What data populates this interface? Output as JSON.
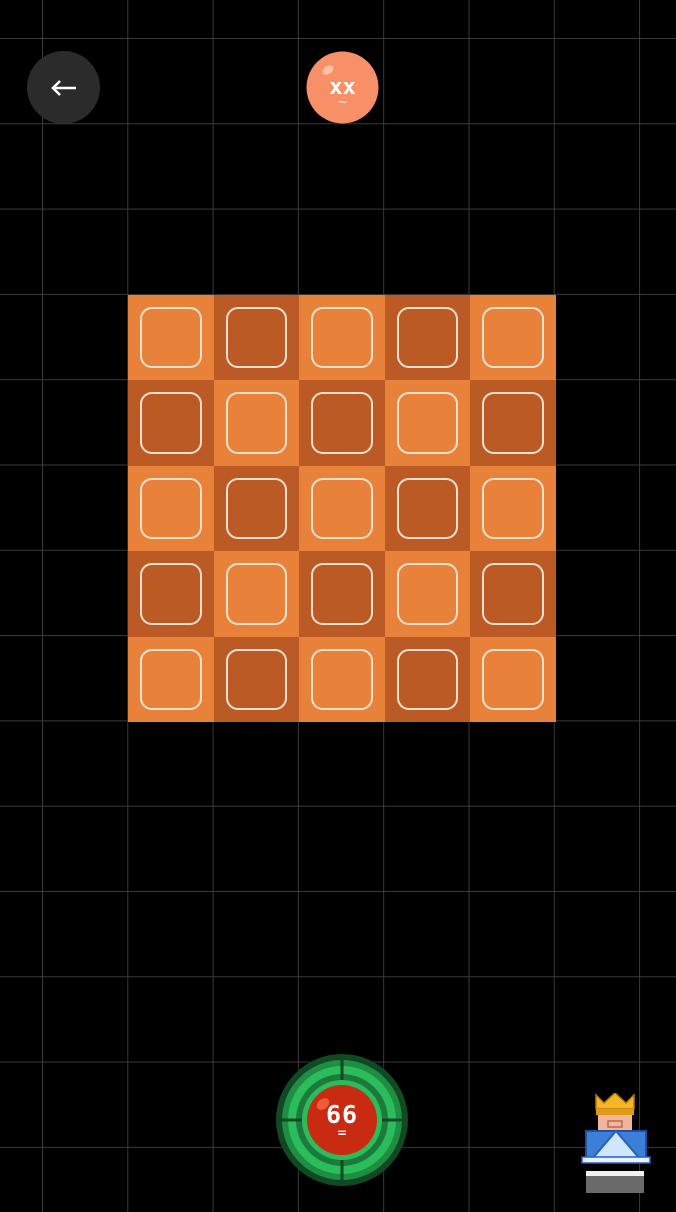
{
  "header": {
    "back_icon": "left-arrow-icon",
    "face_icon": "dizzy-face-icon",
    "face_text": "xx",
    "face_mouth": "~"
  },
  "board": {
    "rows": 5,
    "cols": 5,
    "pattern": [
      [
        "light",
        "dark",
        "light",
        "dark",
        "light"
      ],
      [
        "dark",
        "light",
        "dark",
        "light",
        "dark"
      ],
      [
        "light",
        "dark",
        "light",
        "dark",
        "light"
      ],
      [
        "dark",
        "light",
        "dark",
        "light",
        "dark"
      ],
      [
        "light",
        "dark",
        "light",
        "dark",
        "light"
      ]
    ]
  },
  "counter": {
    "value": "66",
    "symbol": "="
  },
  "king_icon": "king-crown-icon",
  "colors": {
    "background": "#000000",
    "grid_line": "#3a3a3a",
    "tile_light": "#e8823a",
    "tile_dark": "#bc5a26",
    "face_token": "#f79067",
    "counter_ring": "#2bbd5c",
    "counter_core": "#c82a12"
  }
}
